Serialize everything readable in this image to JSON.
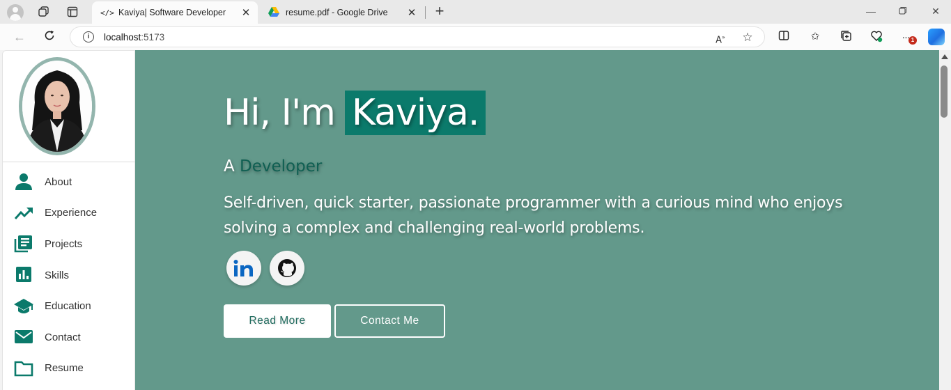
{
  "browser": {
    "tabs": [
      {
        "favicon": "</>",
        "title": "Kaviya| Software Developer",
        "active": true
      },
      {
        "favicon": "google-drive-icon",
        "title": "resume.pdf - Google Drive",
        "active": false
      }
    ],
    "url_host": "localhost",
    "url_port": ":5173",
    "notification_count": "1"
  },
  "sidebar": {
    "items": [
      {
        "label": "About",
        "icon": "person-icon"
      },
      {
        "label": "Experience",
        "icon": "trending-up-icon"
      },
      {
        "label": "Projects",
        "icon": "library-books-icon"
      },
      {
        "label": "Skills",
        "icon": "bar-chart-icon"
      },
      {
        "label": "Education",
        "icon": "graduation-cap-icon"
      },
      {
        "label": "Contact",
        "icon": "envelope-icon"
      },
      {
        "label": "Resume",
        "icon": "folder-icon"
      }
    ]
  },
  "hero": {
    "greeting": "Hi, I'm",
    "name": "Kaviya.",
    "role_prefix": "A",
    "role": "Developer",
    "tagline": "Self-driven, quick starter, passionate programmer with a curious mind who enjoys solving a complex and challenging real-world problems.",
    "buttons": {
      "read_more": "Read More",
      "contact": "Contact Me"
    }
  },
  "colors": {
    "hero_bg": "#63998b",
    "accent": "#0b7a6b",
    "icon": "#0b7a6b"
  }
}
